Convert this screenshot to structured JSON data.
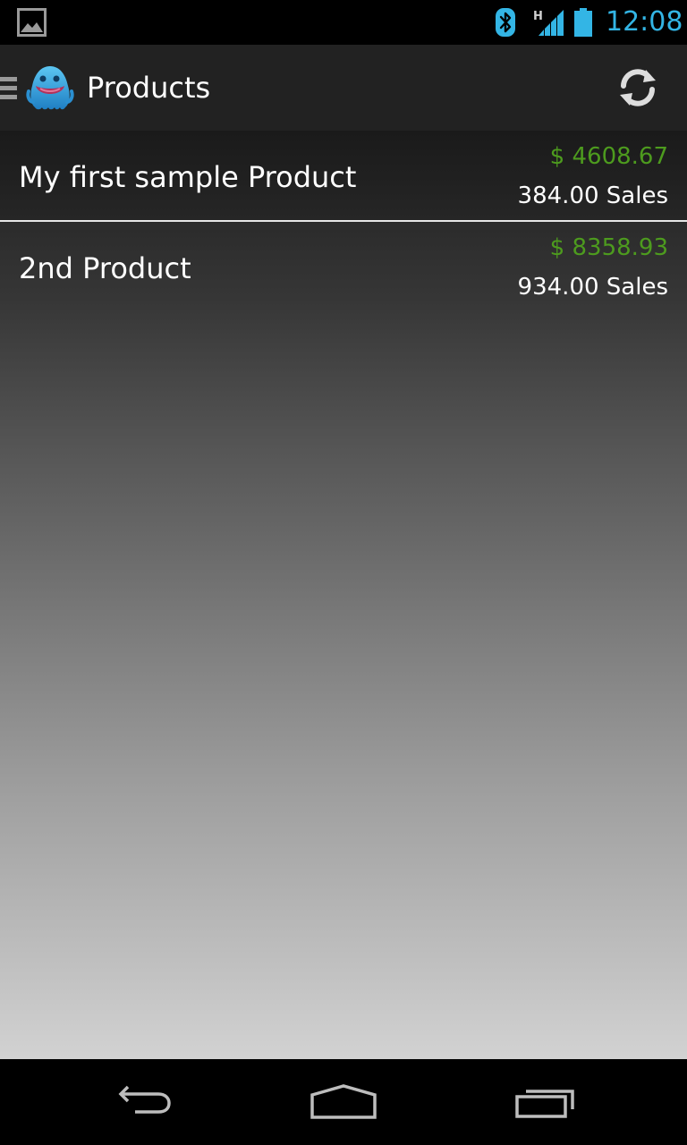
{
  "status_bar": {
    "time": "12:08",
    "network_type": "H",
    "icons": [
      "gallery-notification-icon",
      "bluetooth-icon",
      "signal-icon",
      "battery-icon"
    ],
    "accent_color": "#33b5e5"
  },
  "action_bar": {
    "title": "Products",
    "icons": [
      "drawer-indicator-icon",
      "app-monster-icon",
      "refresh-icon"
    ]
  },
  "products": [
    {
      "name": "My first sample Product",
      "price": "$ 4608.67",
      "sales": "384.00 Sales"
    },
    {
      "name": "2nd Product",
      "price": "$ 8358.93",
      "sales": "934.00 Sales"
    }
  ],
  "colors": {
    "price": "#4d9b1e",
    "text": "#ffffff",
    "action_bar": "#222222"
  },
  "nav_bar": {
    "icons": [
      "back-icon",
      "home-icon",
      "recent-apps-icon"
    ]
  }
}
